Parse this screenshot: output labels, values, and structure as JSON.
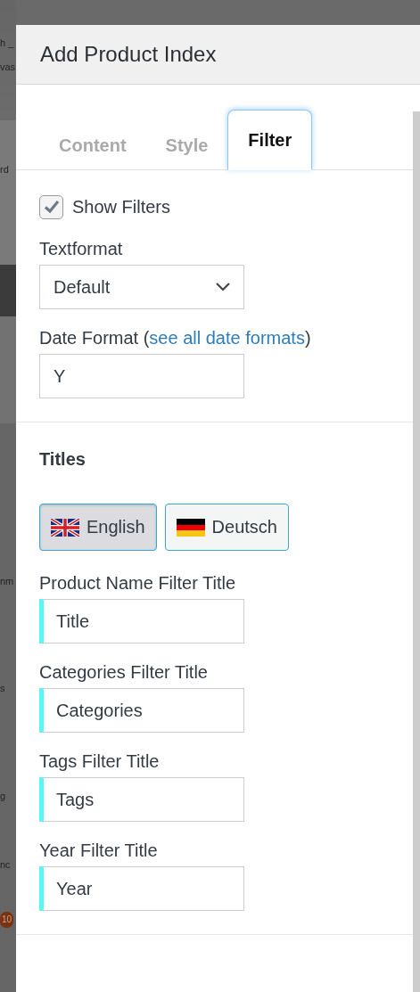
{
  "backdrop": {
    "fragments": [
      {
        "text": "h _",
        "kind": "text"
      },
      {
        "text": "vas",
        "kind": "text"
      },
      {
        "text": "rd",
        "kind": "text"
      },
      {
        "text": "nm",
        "kind": "text"
      },
      {
        "text": "s",
        "kind": "text"
      },
      {
        "text": "g",
        "kind": "text"
      },
      {
        "text": "nc",
        "kind": "text"
      },
      {
        "text": "10",
        "kind": "badge"
      }
    ]
  },
  "dialog": {
    "title": "Add Product Index",
    "tabs": [
      {
        "label": "Content",
        "selected": false
      },
      {
        "label": "Style",
        "selected": false
      },
      {
        "label": "Filter",
        "selected": true
      }
    ],
    "show_filters": {
      "label": "Show Filters",
      "checked": true
    },
    "textformat": {
      "label": "Textformat",
      "value": "Default"
    },
    "date_format": {
      "label": "Date Format (",
      "link": "see all date formats",
      "label_end": ")",
      "value": "Y"
    },
    "titles": {
      "heading": "Titles",
      "languages": [
        {
          "label": "English",
          "kind": "uk",
          "selected": true
        },
        {
          "label": "Deutsch",
          "kind": "de",
          "selected": false
        }
      ],
      "fields": [
        {
          "label": "Product Name Filter Title",
          "value": "Title"
        },
        {
          "label": "Categories Filter Title",
          "value": "Categories"
        },
        {
          "label": "Tags Filter Title",
          "value": "Tags"
        },
        {
          "label": "Year Filter Title",
          "value": "Year"
        }
      ]
    }
  }
}
